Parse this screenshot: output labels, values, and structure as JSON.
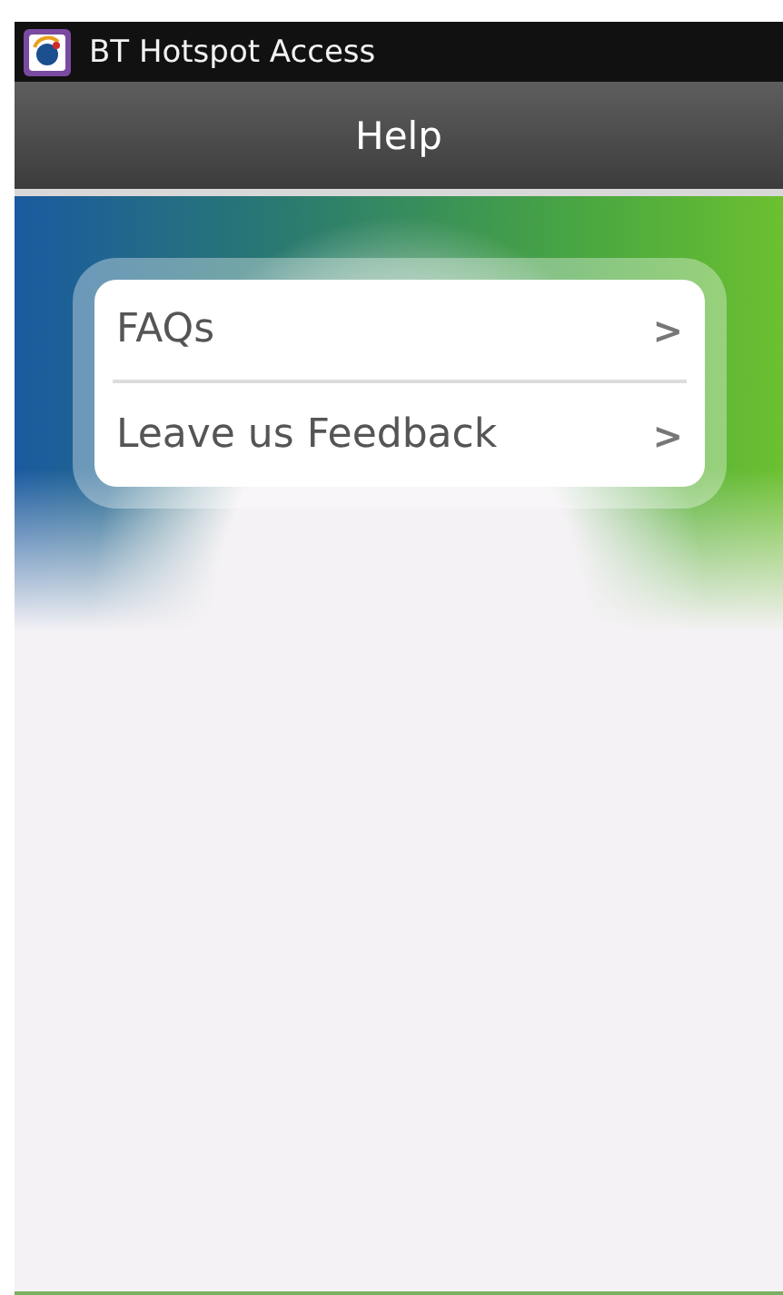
{
  "window": {
    "title": "BT Hotspot Access"
  },
  "header": {
    "title": "Help"
  },
  "menu": [
    {
      "label": "FAQs",
      "chevron": ">"
    },
    {
      "label": "Leave us Feedback",
      "chevron": ">"
    }
  ]
}
